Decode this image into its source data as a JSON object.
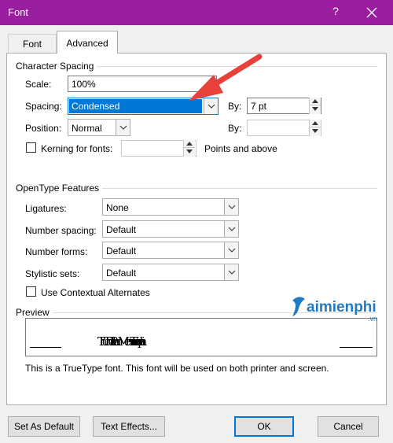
{
  "window": {
    "title": "Font",
    "help": "?"
  },
  "tabs": [
    {
      "label": "Font"
    },
    {
      "label": "Advanced"
    }
  ],
  "character_spacing": {
    "heading": "Character Spacing",
    "scale_label": "Scale:",
    "scale_value": "100%",
    "spacing_label": "Spacing:",
    "spacing_value": "Condensed",
    "spacing_by_label": "By:",
    "spacing_by_value": "7 pt",
    "position_label": "Position:",
    "position_value": "Normal",
    "position_by_label": "By:",
    "position_by_value": "",
    "kerning_label": "Kerning for fonts:",
    "kerning_value": "",
    "kerning_suffix": "Points and above"
  },
  "opentype": {
    "heading": "OpenType Features",
    "ligatures_label": "Ligatures:",
    "ligatures_value": "None",
    "number_spacing_label": "Number spacing:",
    "number_spacing_value": "Default",
    "number_forms_label": "Number forms:",
    "number_forms_value": "Default",
    "stylistic_sets_label": "Stylistic sets:",
    "stylistic_sets_value": "Default",
    "contextual_label": "Use Contextual Alternates"
  },
  "preview": {
    "heading": "Preview",
    "sample": "ThuThuatPhanMem.vn Taimienphi.vn",
    "note": "This is a TrueType font. This font will be used on both printer and screen."
  },
  "buttons": {
    "set_default": "Set As Default",
    "text_effects": "Text Effects...",
    "ok": "OK",
    "cancel": "Cancel"
  },
  "watermark": {
    "brand": "aimienphi",
    "suffix": ".vn"
  },
  "colors": {
    "titlebar": "#9a1ea0",
    "selection": "#0078d7",
    "annotation_arrow": "#e8413c",
    "watermark": "#1e7bc2"
  },
  "icons": [
    "close-icon",
    "chevron-down-icon",
    "spin-up-icon",
    "spin-down-icon",
    "annotation-arrow",
    "taimienphi-logo-icon"
  ]
}
